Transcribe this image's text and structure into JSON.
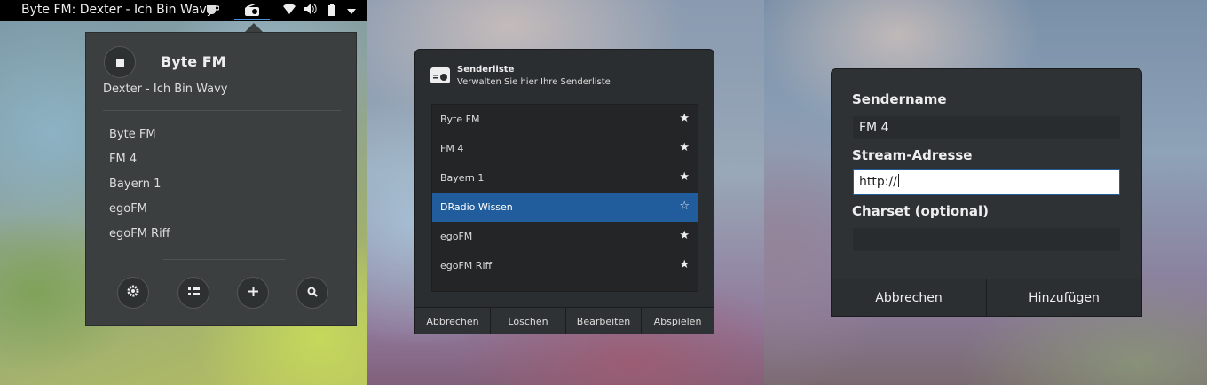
{
  "topbar": {
    "title": "Byte FM: Dexter - Ich Bin Wavy",
    "icons": [
      "coffee-icon",
      "radio-icon",
      "wifi-icon",
      "volume-icon",
      "battery-icon",
      "dropdown-icon"
    ]
  },
  "popup": {
    "station": "Byte FM",
    "song": "Dexter - Ich Bin Wavy",
    "stations": [
      "Byte FM",
      "FM 4",
      "Bayern 1",
      "egoFM",
      "egoFM Riff"
    ],
    "buttons": [
      "settings-icon",
      "list-icon",
      "add-icon",
      "search-icon"
    ]
  },
  "station_manager": {
    "title": "Senderliste",
    "subtitle": "Verwalten Sie hier Ihre Senderliste",
    "rows": [
      {
        "name": "Byte FM",
        "favorite": true,
        "selected": false
      },
      {
        "name": "FM 4",
        "favorite": true,
        "selected": false
      },
      {
        "name": "Bayern 1",
        "favorite": true,
        "selected": false
      },
      {
        "name": "DRadio Wissen",
        "favorite": false,
        "selected": true
      },
      {
        "name": "egoFM",
        "favorite": true,
        "selected": false
      },
      {
        "name": "egoFM Riff",
        "favorite": true,
        "selected": false
      }
    ],
    "star_filled": "★",
    "star_empty": "☆",
    "buttons": [
      "Abbrechen",
      "Löschen",
      "Bearbeiten",
      "Abspielen"
    ]
  },
  "add_station": {
    "name_label": "Sendername",
    "name_value": "FM 4",
    "stream_label": "Stream-Adresse",
    "stream_value": "http://",
    "charset_label": "Charset (optional)",
    "charset_value": "",
    "cancel": "Abbrechen",
    "add": "Hinzufügen"
  },
  "colors": {
    "accent": "#4a90d9",
    "selection": "#215d9c",
    "dialog_bg": "#2b2e30",
    "popup_bg": "#3b3f40"
  }
}
